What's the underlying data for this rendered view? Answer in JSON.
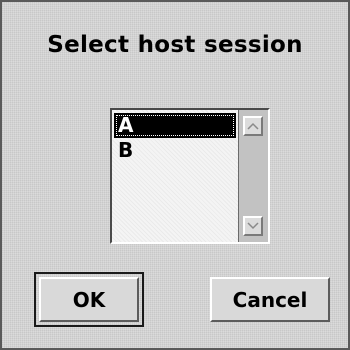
{
  "dialog": {
    "title": "Select host session",
    "sessions": [
      "A",
      "B"
    ],
    "selected_index": 0,
    "buttons": {
      "ok_label": "OK",
      "cancel_label": "Cancel"
    }
  }
}
